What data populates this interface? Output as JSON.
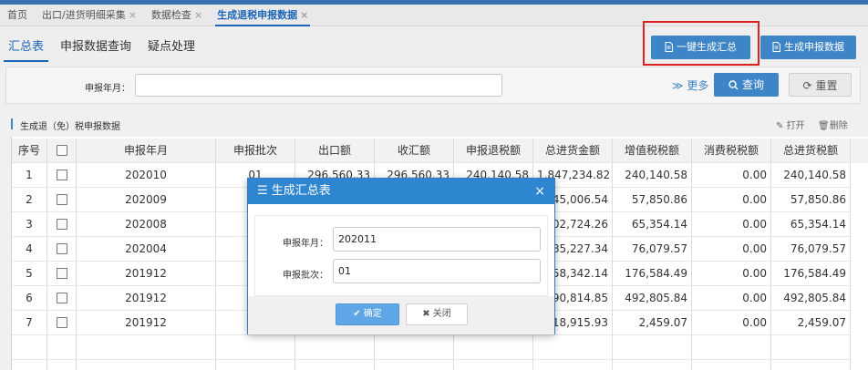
{
  "tabs": [
    {
      "label": "首页",
      "closable": false
    },
    {
      "label": "出口/进货明细采集",
      "closable": true
    },
    {
      "label": "数据检查",
      "closable": true
    },
    {
      "label": "生成退税申报数据",
      "closable": true,
      "active": true
    }
  ],
  "subtabs": [
    "汇总表",
    "申报数据查询",
    "疑点处理"
  ],
  "actions": {
    "generate_summary": "一键生成汇总",
    "generate_declare": "生成申报数据"
  },
  "search": {
    "label": "申报年月：",
    "more": "更多",
    "query": "查询",
    "reset": "重置"
  },
  "grid": {
    "title": "生成退（免）税申报数据",
    "open": "打开",
    "delete": "删除"
  },
  "table": {
    "headers": [
      "序号",
      "",
      "申报年月",
      "申报批次",
      "出口额",
      "收汇额",
      "申报退税额",
      "总进货金额",
      "增值税税额",
      "消费税税额",
      "总进货税额"
    ],
    "rows": [
      [
        "1",
        "202010",
        "01",
        "296,560.33",
        "296,560.33",
        "240,140.58",
        "1,847,234.82",
        "240,140.58",
        "0.00",
        "240,140.58"
      ],
      [
        "2",
        "202009",
        "",
        "",
        "",
        "",
        "445,006.54",
        "57,850.86",
        "0.00",
        "57,850.86"
      ],
      [
        "3",
        "202008",
        "",
        "",
        "",
        "",
        "502,724.26",
        "65,354.14",
        "0.00",
        "65,354.14"
      ],
      [
        "4",
        "202004",
        "",
        "",
        "",
        "",
        "585,227.34",
        "76,079.57",
        "0.00",
        "76,079.57"
      ],
      [
        "5",
        "201912",
        "",
        "",
        "",
        "",
        "358,342.14",
        "176,584.49",
        "0.00",
        "176,584.49"
      ],
      [
        "6",
        "201912",
        "",
        "",
        "",
        "",
        "790,814.85",
        "492,805.84",
        "0.00",
        "492,805.84"
      ],
      [
        "7",
        "201912",
        "",
        "",
        "",
        "",
        "18,915.93",
        "2,459.07",
        "0.00",
        "2,459.07"
      ]
    ]
  },
  "dialog": {
    "title": "生成汇总表",
    "year_label": "申报年月：",
    "year_value": "202011",
    "batch_label": "申报批次：",
    "batch_value": "01",
    "ok": "确定",
    "close": "关闭"
  },
  "colors": {
    "accent": "#3d85c6",
    "highlight": "#e02020"
  }
}
